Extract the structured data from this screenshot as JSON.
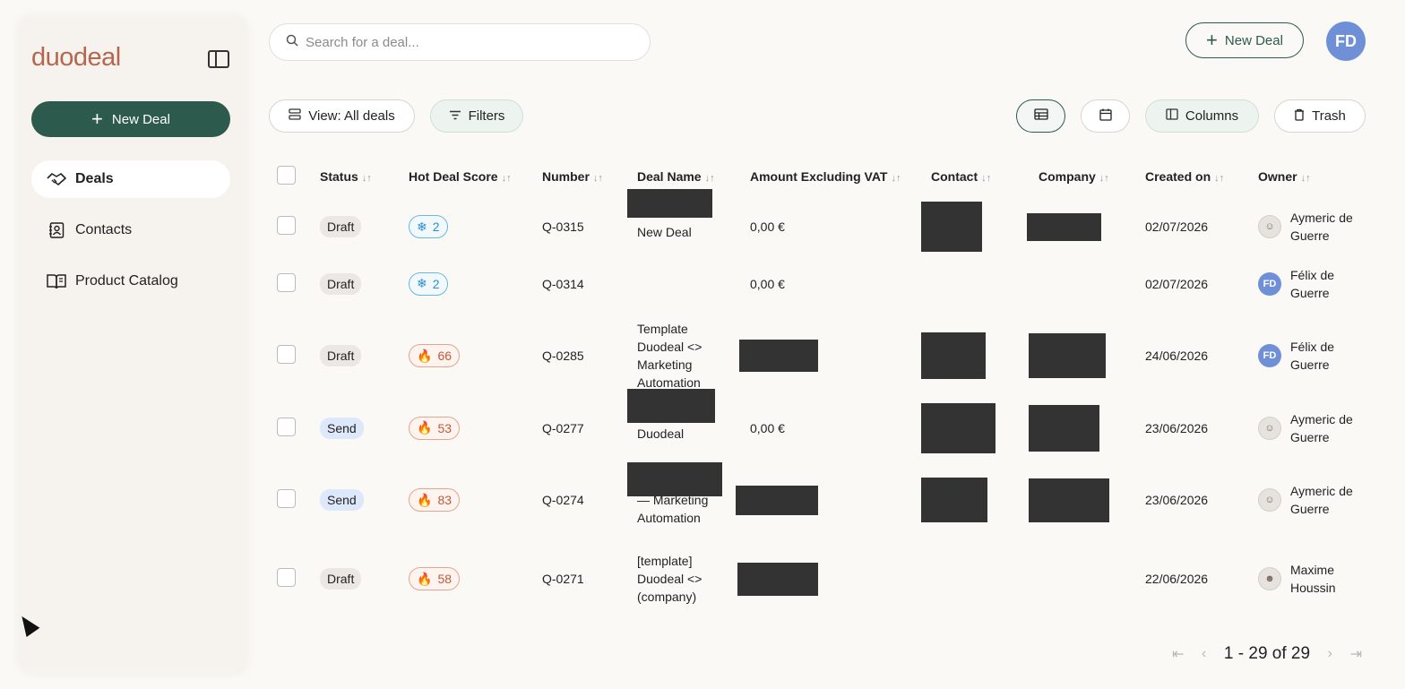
{
  "sidebar": {
    "logo": "duodeal",
    "new_deal_label": "New Deal",
    "items": [
      {
        "label": "Deals",
        "icon": "handshake-icon",
        "active": true
      },
      {
        "label": "Contacts",
        "icon": "contact-card-icon",
        "active": false
      },
      {
        "label": "Product Catalog",
        "icon": "book-icon",
        "active": false
      }
    ]
  },
  "header": {
    "search_placeholder": "Search for a deal...",
    "new_deal_label": "New Deal",
    "user_initials": "FD"
  },
  "toolbar": {
    "view_label": "View: All deals",
    "filters_label": "Filters",
    "columns_label": "Columns",
    "trash_label": "Trash"
  },
  "table": {
    "columns": [
      "Status",
      "Hot Deal Score",
      "Number",
      "Deal Name",
      "Amount Excluding VAT",
      "Contact",
      "Company",
      "Created on",
      "Owner"
    ],
    "rows": [
      {
        "status": "Draft",
        "score": "2",
        "number": "Q-0315",
        "deal_name": "New Deal",
        "amount": "0,00 €",
        "created": "02/07/2026",
        "owner": "Aymeric de Guerre"
      },
      {
        "status": "Draft",
        "score": "2",
        "number": "Q-0314",
        "deal_name": "",
        "amount": "0,00 €",
        "created": "02/07/2026",
        "owner": "Félix de Guerre"
      },
      {
        "status": "Draft",
        "score": "66",
        "number": "Q-0285",
        "deal_name": "Template Duodeal <> Marketing Automation",
        "amount": "",
        "created": "24/06/2026",
        "owner": "Félix de Guerre"
      },
      {
        "status": "Send",
        "score": "53",
        "number": "Q-0277",
        "deal_name": "Duodeal",
        "amount": "0,00 €",
        "created": "23/06/2026",
        "owner": "Aymeric de Guerre"
      },
      {
        "status": "Send",
        "score": "83",
        "number": "Q-0274",
        "deal_name": "— Marketing Automation",
        "amount": "",
        "created": "23/06/2026",
        "owner": "Aymeric de Guerre"
      },
      {
        "status": "Draft",
        "score": "58",
        "number": "Q-0271",
        "deal_name": "[template] Duodeal <> (company)",
        "amount": "",
        "created": "22/06/2026",
        "owner": "Maxime Houssin"
      }
    ]
  },
  "pagination": {
    "range": "1 - 29 of 29"
  },
  "colors": {
    "brand": "#2c5a4c",
    "logo": "#b6654e",
    "avatar": "#6f8fd6"
  }
}
